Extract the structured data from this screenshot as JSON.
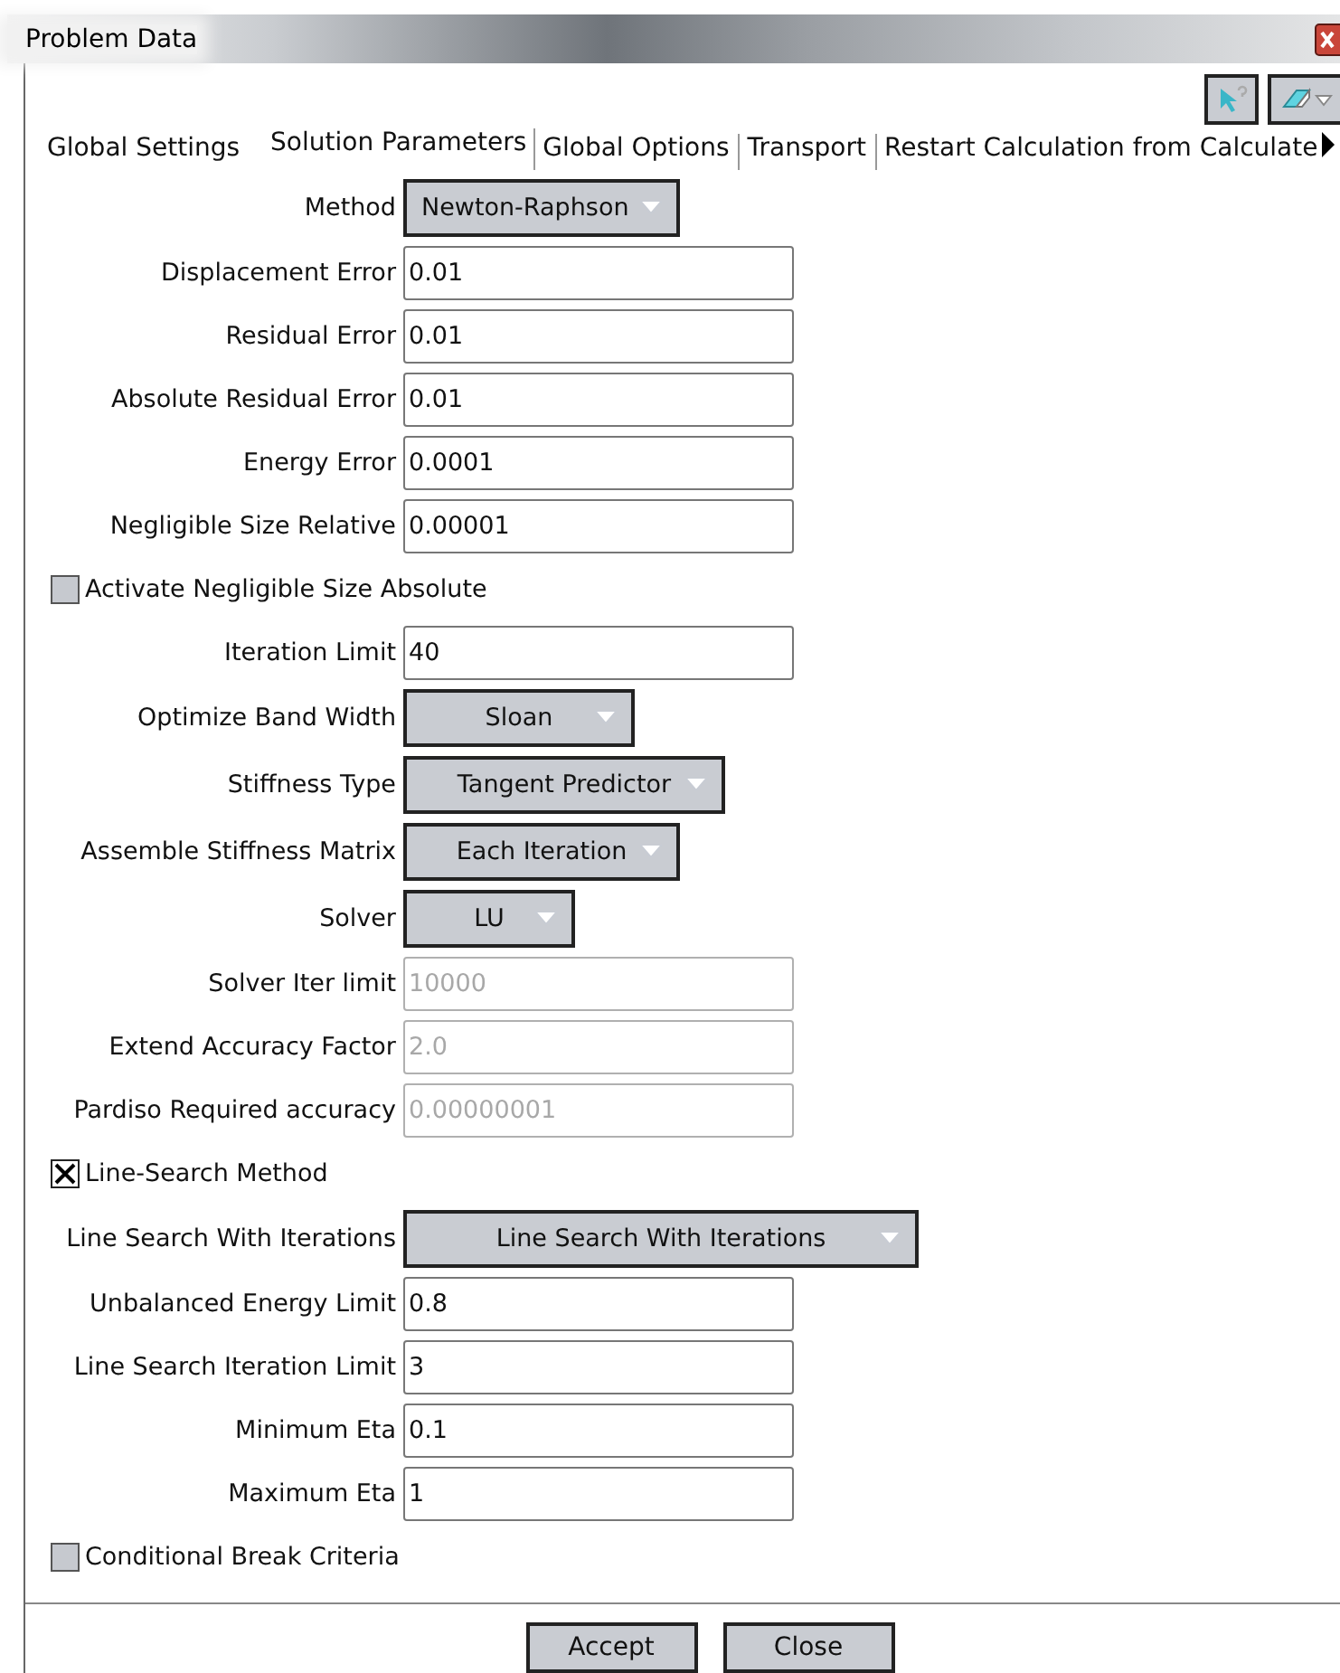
{
  "window": {
    "title": "Problem Data"
  },
  "tabs": [
    {
      "label": "Global Settings",
      "selected": false
    },
    {
      "label": "Solution Parameters",
      "selected": true
    },
    {
      "label": "Global Options",
      "selected": false
    },
    {
      "label": "Transport",
      "selected": false
    },
    {
      "label": "Restart Calculation from Calculate",
      "selected": false
    }
  ],
  "rows": [
    {
      "kind": "select",
      "label": "Method",
      "value": "Newton-Raphson"
    },
    {
      "kind": "field",
      "label": "Displacement Error",
      "value": "0.01",
      "disabled": false
    },
    {
      "kind": "field",
      "label": "Residual Error",
      "value": "0.01",
      "disabled": false
    },
    {
      "kind": "field",
      "label": "Absolute Residual Error",
      "value": "0.01",
      "disabled": false
    },
    {
      "kind": "field",
      "label": "Energy Error",
      "value": "0.0001",
      "disabled": false
    },
    {
      "kind": "field",
      "label": "Negligible Size Relative",
      "value": "0.00001",
      "disabled": false
    },
    {
      "kind": "checkbox",
      "label": "Activate Negligible Size Absolute",
      "checked": false
    },
    {
      "kind": "field",
      "label": "Iteration Limit",
      "value": "40",
      "disabled": false
    },
    {
      "kind": "select",
      "label": "Optimize Band Width",
      "value": "Sloan"
    },
    {
      "kind": "select",
      "label": "Stiffness Type",
      "value": "Tangent Predictor"
    },
    {
      "kind": "select",
      "label": "Assemble Stiffness Matrix",
      "value": "Each Iteration"
    },
    {
      "kind": "select",
      "label": "Solver",
      "value": "LU"
    },
    {
      "kind": "field",
      "label": "Solver Iter limit",
      "value": "10000",
      "disabled": true
    },
    {
      "kind": "field",
      "label": "Extend Accuracy Factor",
      "value": "2.0",
      "disabled": true
    },
    {
      "kind": "field",
      "label": "Pardiso Required accuracy",
      "value": "0.00000001",
      "disabled": true
    },
    {
      "kind": "checkbox",
      "label": "Line-Search Method",
      "checked": true
    },
    {
      "kind": "select",
      "label": "Line Search With Iterations",
      "value": "Line Search With Iterations"
    },
    {
      "kind": "field",
      "label": "Unbalanced Energy Limit",
      "value": "0.8",
      "disabled": false
    },
    {
      "kind": "field",
      "label": "Line Search Iteration Limit",
      "value": "3",
      "disabled": false
    },
    {
      "kind": "field",
      "label": "Minimum Eta",
      "value": "0.1",
      "disabled": false
    },
    {
      "kind": "field",
      "label": "Maximum Eta",
      "value": "1",
      "disabled": false
    },
    {
      "kind": "checkbox",
      "label": "Conditional Break Criteria",
      "checked": false
    }
  ],
  "buttons": [
    "Accept",
    "Close"
  ]
}
